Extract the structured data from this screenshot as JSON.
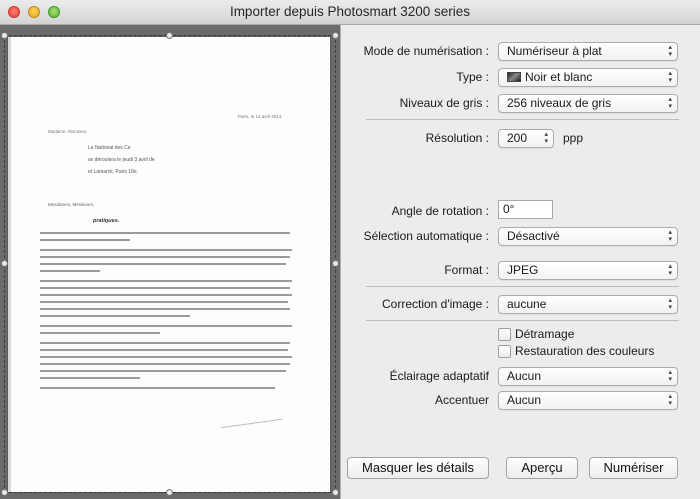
{
  "window": {
    "title": "Importer depuis Photosmart 3200 series"
  },
  "preview": {
    "document": {
      "date": "Paris, le 14 avril 2014",
      "recipient": "Madame, Monsieur,",
      "header_lines": [
        "Le                         National des Ce",
        "se déroulera le jeudi 3 avril de",
        "et Lamarck, Paris 18e."
      ],
      "greeting": "Mesdames, Messieurs,",
      "object": "pratiques."
    }
  },
  "settings": {
    "scan_mode": {
      "label": "Mode de numérisation :",
      "value": "Numériseur à plat"
    },
    "type": {
      "label": "Type :",
      "value": "Noir et blanc",
      "icon": "bw-image-icon"
    },
    "gray_levels": {
      "label": "Niveaux de gris :",
      "value": "256 niveaux de gris"
    },
    "resolution": {
      "label": "Résolution :",
      "value": "200",
      "unit": "ppp"
    },
    "rotation": {
      "label": "Angle de rotation :",
      "value": "0°"
    },
    "auto_selection": {
      "label": "Sélection automatique :",
      "value": "Désactivé"
    },
    "format": {
      "label": "Format :",
      "value": "JPEG"
    },
    "image_correction": {
      "label": "Correction d'image :",
      "value": "aucune"
    },
    "descreen": {
      "label": "Détramage",
      "checked": false
    },
    "color_restore": {
      "label": "Restauration des couleurs",
      "checked": false
    },
    "adaptive_lighting": {
      "label": "Éclairage adaptatif",
      "value": "Aucun"
    },
    "sharpen": {
      "label": "Accentuer",
      "value": "Aucun"
    }
  },
  "buttons": {
    "hide_details": "Masquer les détails",
    "overview": "Aperçu",
    "scan": "Numériser"
  }
}
